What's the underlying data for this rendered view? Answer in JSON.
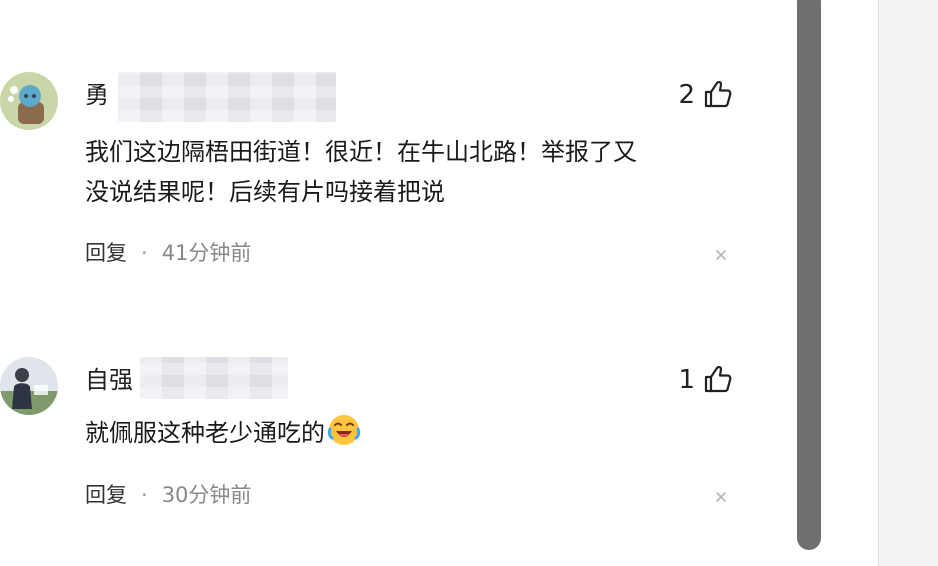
{
  "comments": [
    {
      "username": "勇",
      "avatar": "cartoon-avatar",
      "likes": "2",
      "content_lines": [
        "我们这边隔梧田街道！很近！在牛山北路！举报了又",
        "没说结果呢！后续有片吗接着把说"
      ],
      "reply_label": "回复",
      "separator": "·",
      "time": "41分钟前"
    },
    {
      "username": "自强",
      "avatar": "photo-avatar",
      "likes": "1",
      "content_text": "就佩服这种老少通吃的",
      "emoji": "laughing-crying-emoji",
      "reply_label": "回复",
      "separator": "·",
      "time": "30分钟前"
    }
  ],
  "icons": {
    "like": "thumbs-up-icon",
    "dismiss": "close-icon"
  },
  "colors": {
    "text": "#222222",
    "meta": "#888888",
    "scrollbar": "#6f6f6f"
  }
}
